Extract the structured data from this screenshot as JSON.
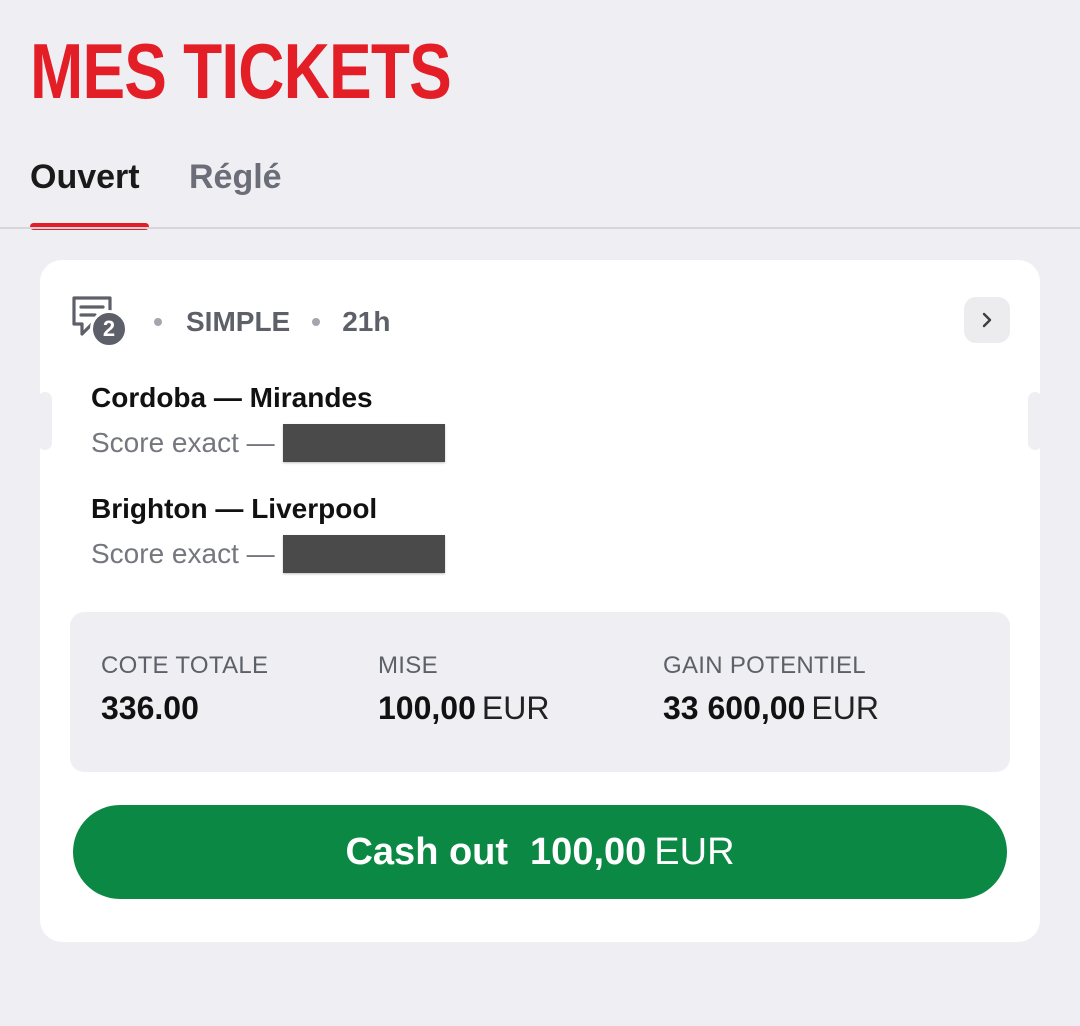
{
  "header": {
    "title": "MES TICKETS"
  },
  "tabs": [
    {
      "label": "Ouvert",
      "active": true
    },
    {
      "label": "Réglé",
      "active": false
    }
  ],
  "ticket": {
    "selection_count": "2",
    "bet_type": "SIMPLE",
    "time": "21h",
    "selections": [
      {
        "match": "Cordoba — Mirandes",
        "market": "Score exact —"
      },
      {
        "match": "Brighton — Liverpool",
        "market": "Score exact —"
      }
    ],
    "summary": {
      "odds_label": "COTE TOTALE",
      "odds_value": "336.00",
      "stake_label": "MISE",
      "stake_value": "100,00",
      "stake_currency": "EUR",
      "gain_label": "GAIN POTENTIEL",
      "gain_value": "33 600,00",
      "gain_currency": "EUR"
    },
    "cashout": {
      "label": "Cash out",
      "amount": "100,00",
      "currency": "EUR"
    }
  },
  "colors": {
    "brand_red": "#e41e26",
    "cashout_green": "#0b8944",
    "background": "#efeff3"
  },
  "icons": {
    "ticket": "ticket-list-icon",
    "chevron": "chevron-right-icon"
  }
}
